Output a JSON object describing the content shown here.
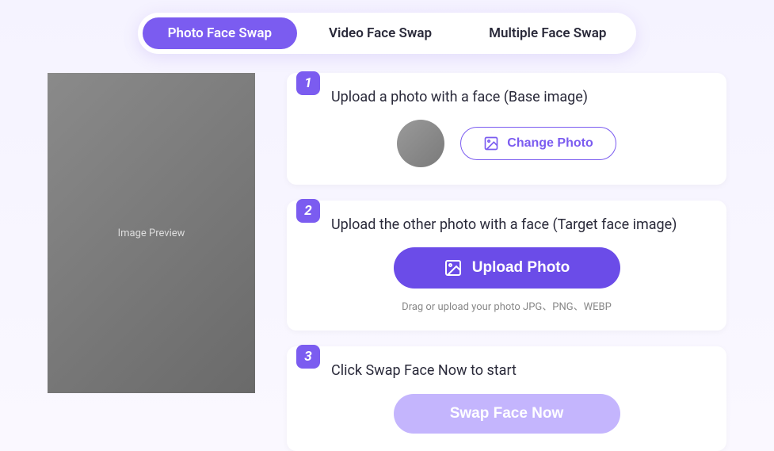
{
  "tabs": {
    "photo": "Photo Face Swap",
    "video": "Video Face Swap",
    "multiple": "Multiple Face Swap"
  },
  "steps": {
    "s1": {
      "num": "1",
      "title": "Upload a photo with a face (Base image)",
      "changeBtn": "Change Photo"
    },
    "s2": {
      "num": "2",
      "title": "Upload the other photo with a face (Target face image)",
      "uploadBtn": "Upload Photo",
      "hint": "Drag or upload your photo  JPG、PNG、WEBP"
    },
    "s3": {
      "num": "3",
      "title": "Click Swap Face Now to start",
      "swapBtn": "Swap Face Now"
    }
  },
  "previewPlaceholder": "Image Preview"
}
